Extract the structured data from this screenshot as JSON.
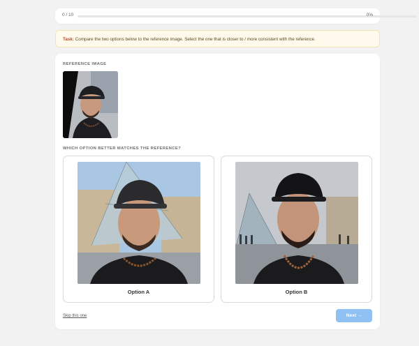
{
  "progress": {
    "count_label": "0 / 10",
    "percent_label": "0%",
    "fraction": 0
  },
  "task": {
    "prefix": "Task:",
    "text": " Compare the two options below to the reference image. Select the one that is closer to / more consistent with the reference."
  },
  "reference": {
    "section_label": "REFERENCE IMAGE"
  },
  "question": {
    "section_label": "WHICH OPTION BETTER MATCHES THE REFERENCE?"
  },
  "options": [
    {
      "label": "Option A"
    },
    {
      "label": "Option B"
    }
  ],
  "footer": {
    "skip_label": "Skip this one",
    "next_label": "Next →"
  },
  "colors": {
    "accent": "#4a90e2",
    "next_button": "#8fc1f3",
    "task_background": "#fffaeb",
    "task_prefix": "#b24a2a"
  }
}
